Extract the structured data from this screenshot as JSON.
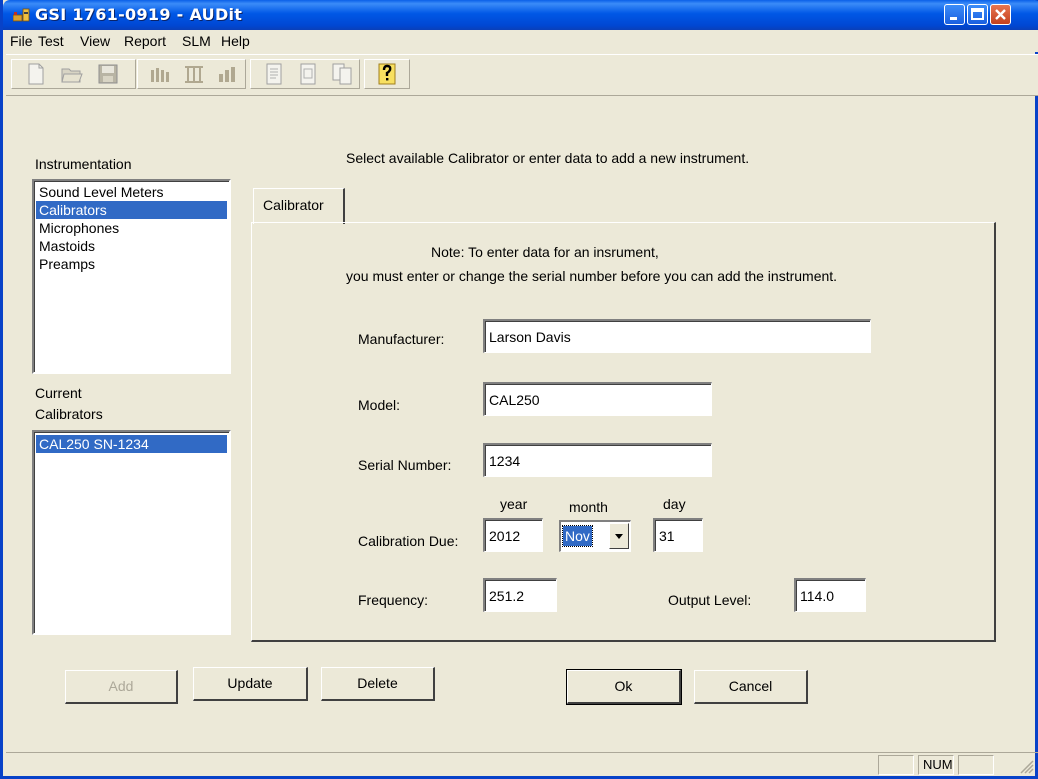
{
  "window": {
    "title": "GSI 1761-0919 - AUDit"
  },
  "menu": [
    "File",
    "Test",
    "View",
    "Report",
    "SLM",
    "Help"
  ],
  "toolbar": {
    "icons": [
      "new-file",
      "open-folder",
      "save",
      "instrument-a",
      "instrument-b",
      "instrument-c",
      "report-a",
      "report-b",
      "report-c",
      "help-question"
    ]
  },
  "left": {
    "instrumentation_label": "Instrumentation",
    "instrumentation_items": [
      "Sound Level Meters",
      "Calibrators",
      "Microphones",
      "Mastoids",
      "Preamps"
    ],
    "selected_index": 1,
    "current_label_line1": "Current",
    "current_label_line2": "Calibrators",
    "current_items": [
      "CAL250 SN-1234"
    ]
  },
  "instruction": "Select available Calibrator or enter data to add a new instrument.",
  "tab": {
    "label": "Calibrator"
  },
  "note": {
    "line1": "Note:  To enter data for an insrument,",
    "line2": "you must enter or change the serial number before you can add the instrument."
  },
  "form": {
    "manufacturer_label": "Manufacturer:",
    "manufacturer_value": "Larson Davis",
    "model_label": "Model:",
    "model_value": "CAL250",
    "serial_label": "Serial Number:",
    "serial_value": "1234",
    "year_label": "year",
    "month_label": "month",
    "day_label": "day",
    "cal_due_label": "Calibration Due:",
    "year_value": "2012",
    "month_value": "Nov",
    "day_value": "31",
    "frequency_label": "Frequency:",
    "frequency_value": "251.2",
    "output_label": "Output Level:",
    "output_value": "114.0"
  },
  "buttons": {
    "add": "Add",
    "update": "Update",
    "delete": "Delete",
    "ok": "Ok",
    "cancel": "Cancel"
  },
  "status": {
    "num": "NUM"
  },
  "colors": {
    "titlebar": "#0058E6",
    "selection": "#316AC5",
    "face": "#ECE9D8"
  }
}
